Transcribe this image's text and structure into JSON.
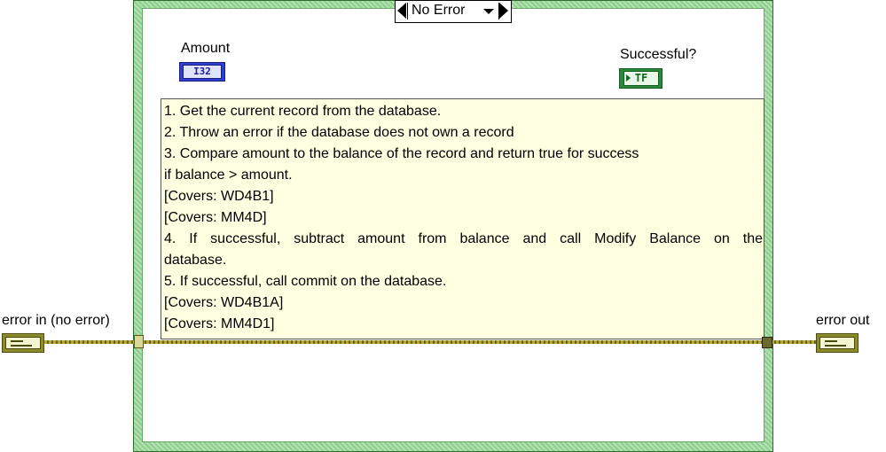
{
  "case_structure": {
    "selector_value": "No Error",
    "colors": {
      "frame": "#8ccf8c",
      "wire": "#8a7f1f",
      "comment_bg": "#ffffe1"
    }
  },
  "controls": {
    "amount": {
      "label": "Amount",
      "type_badge": "I32"
    },
    "successful": {
      "label": "Successful?",
      "type_badge": "TF"
    },
    "error_in": {
      "label": "error in (no error)"
    },
    "error_out": {
      "label": "error out"
    }
  },
  "comment": {
    "lines": [
      "1.  Get the current record from the database.",
      "2.  Throw an error if the database does not own a record",
      "3.  Compare amount to the balance of the record and return true for success",
      "if balance > amount.",
      "[Covers: WD4B1]",
      "[Covers: MM4D]",
      "4.  If successful, subtract amount from balance and call Modify Balance on the",
      "database.",
      "5.  If successful, call commit on the database.",
      "[Covers: WD4B1A]",
      "[Covers: MM4D1]"
    ]
  }
}
